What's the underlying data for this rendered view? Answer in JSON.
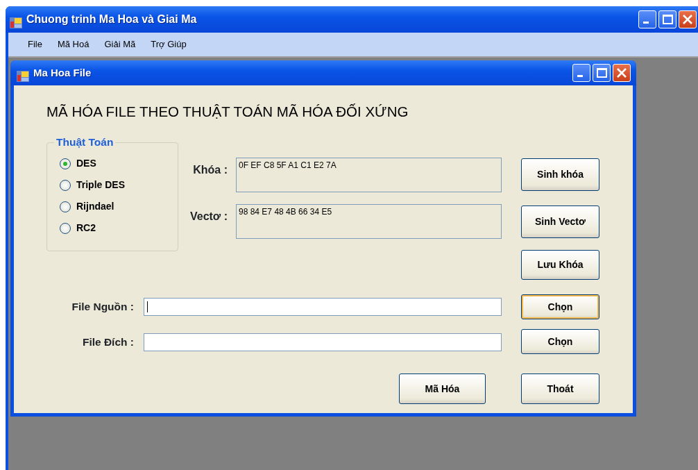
{
  "window": {
    "title": "Chuong trinh Ma Hoa và Giai Ma"
  },
  "menu": [
    "File",
    "Mã Hoá",
    "Giải Mã",
    "Trợ Giúp"
  ],
  "child_window": {
    "title": "Ma Hoa File",
    "heading": "MÃ HÓA FILE THEO THUẬT TOÁN MÃ HÓA ĐỐI XỨNG",
    "algorithm_group": {
      "title": "Thuật Toán",
      "options": [
        {
          "label": "DES",
          "selected": true
        },
        {
          "label": "Triple DES",
          "selected": false
        },
        {
          "label": "Rijndael",
          "selected": false
        },
        {
          "label": "RC2",
          "selected": false
        }
      ]
    },
    "key_fields": [
      {
        "label": "Khóa :",
        "value": "0F EF C8 5F A1 C1 E2 7A"
      },
      {
        "label": "Vectơ :",
        "value": "98 84 E7 48 4B 66 34 E5"
      }
    ],
    "side_buttons": [
      "Sinh khóa",
      "Sinh Vectơ",
      "Lưu Khóa"
    ],
    "file_rows": [
      {
        "label": "File Nguồn :",
        "cursor": true,
        "button": "Chọn",
        "focused": true
      },
      {
        "label": "File Đích :",
        "cursor": false,
        "button": "Chọn",
        "focused": false
      }
    ],
    "encrypt_button": "Mã Hóa",
    "exit_button": "Thoát"
  }
}
